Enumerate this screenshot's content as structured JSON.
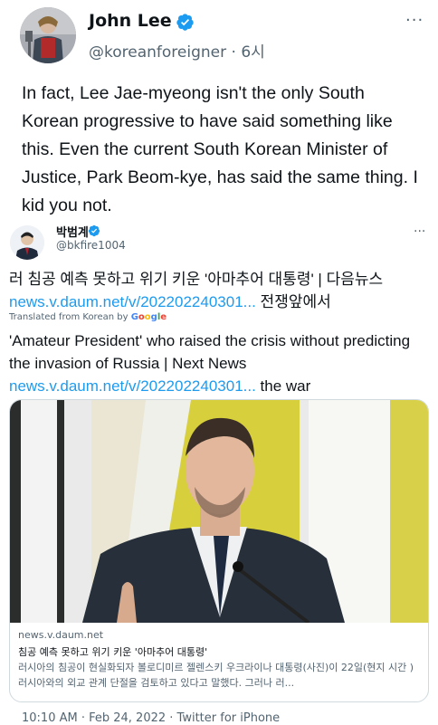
{
  "tweet": {
    "author_name": "John Lee",
    "handle": "@koreanforeigner",
    "time": "6시",
    "more_label": "···",
    "text": "In fact, Lee Jae-myeong isn't the only South Korean progressive to have said something like this. Even the current South Korean Minister of Justice, Park Beom-kye, has said the same thing. I kid you not.",
    "footer": "10:10 AM · Feb 24, 2022 · Twitter for iPhone"
  },
  "quote": {
    "author_name": "박범계",
    "handle": "@bkfire1004",
    "more_label": "···",
    "text_ko_prefix": "러 침공 예측 못하고 위기 키운 '아마추어 대통령' | 다음뉴스 ",
    "text_ko_link": "news.v.daum.net/v/202202240301...",
    "text_ko_suffix": " 전쟁앞에서",
    "translated_label": "Translated from Korean by ",
    "google_letters": [
      "G",
      "o",
      "o",
      "g",
      "l",
      "e"
    ],
    "text_en_prefix": "'Amateur President' who raised the crisis without predicting the invasion of Russia | Next News ",
    "text_en_link": "news.v.daum.net/v/202202240301...",
    "text_en_suffix": " the war"
  },
  "link_card": {
    "domain": "news.v.daum.net",
    "title": "침공 예측 못하고 위기 키운 '아마추어 대통령'",
    "description": "러시아의 침공이 현실화되자 볼로디미르 젤렌스키 우크라이나 대통령(사진)이 22일(현지 시간 ) 러시아와의 외교 관계 단절을 검토하고 있다고 말했다. 그러나 러..."
  },
  "colors": {
    "link": "#1d9bf0",
    "verified": "#1d9bf0",
    "secondary_text": "#536471"
  }
}
